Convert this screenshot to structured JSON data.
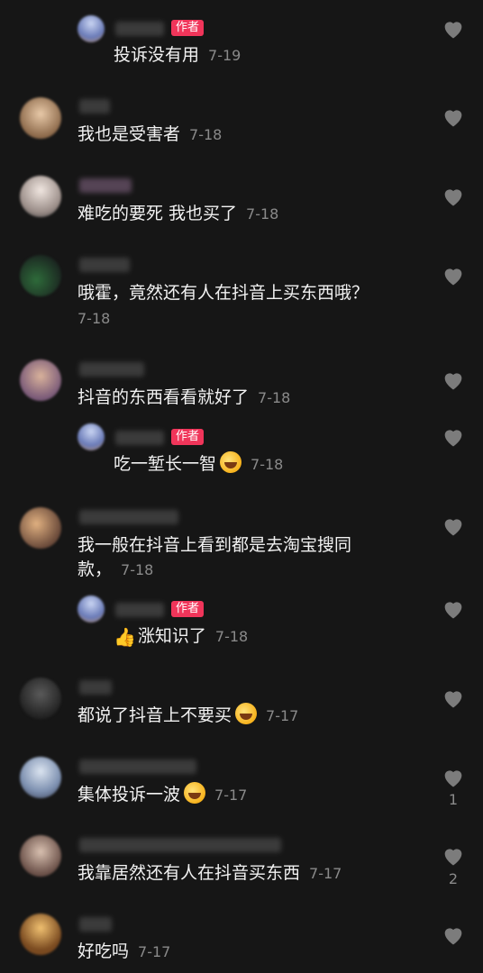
{
  "author_tag": "作者",
  "colors": {
    "background": "#161616",
    "author_tag": "#f0355a",
    "date": "#8a8a8a",
    "heart": "#7c7c7c"
  },
  "comments": [
    {
      "text": "投诉没有用",
      "date": "7-19",
      "reply": true,
      "author": true
    },
    {
      "text": "我也是受害者",
      "date": "7-18"
    },
    {
      "text": "难吃的要死 我也买了",
      "date": "7-18"
    },
    {
      "text_line1": "哦霍，竟然还有人在抖音上买东西哦？",
      "date": "7-18"
    },
    {
      "text": "抖音的东西看看就好了",
      "date": "7-18"
    },
    {
      "text": "吃一堑长一智",
      "date": "7-18",
      "reply": true,
      "author": true,
      "emoji": "laughing-emoji"
    },
    {
      "text_line1": "我一般在抖音上看到都是去淘宝搜同",
      "text_line2": "款，",
      "date": "7-18"
    },
    {
      "text": "涨知识了",
      "date": "7-18",
      "reply": true,
      "author": true,
      "emoji": "thumbs-up-emoji"
    },
    {
      "text": "都说了抖音上不要买",
      "date": "7-17",
      "emoji": "laughing-emoji"
    },
    {
      "text": "集体投诉一波",
      "date": "7-17",
      "emoji": "laughing-emoji",
      "likes": "1"
    },
    {
      "text": "我靠居然还有人在抖音买东西",
      "date": "7-17",
      "likes": "2"
    },
    {
      "text": "好吃吗",
      "date": "7-17"
    }
  ]
}
